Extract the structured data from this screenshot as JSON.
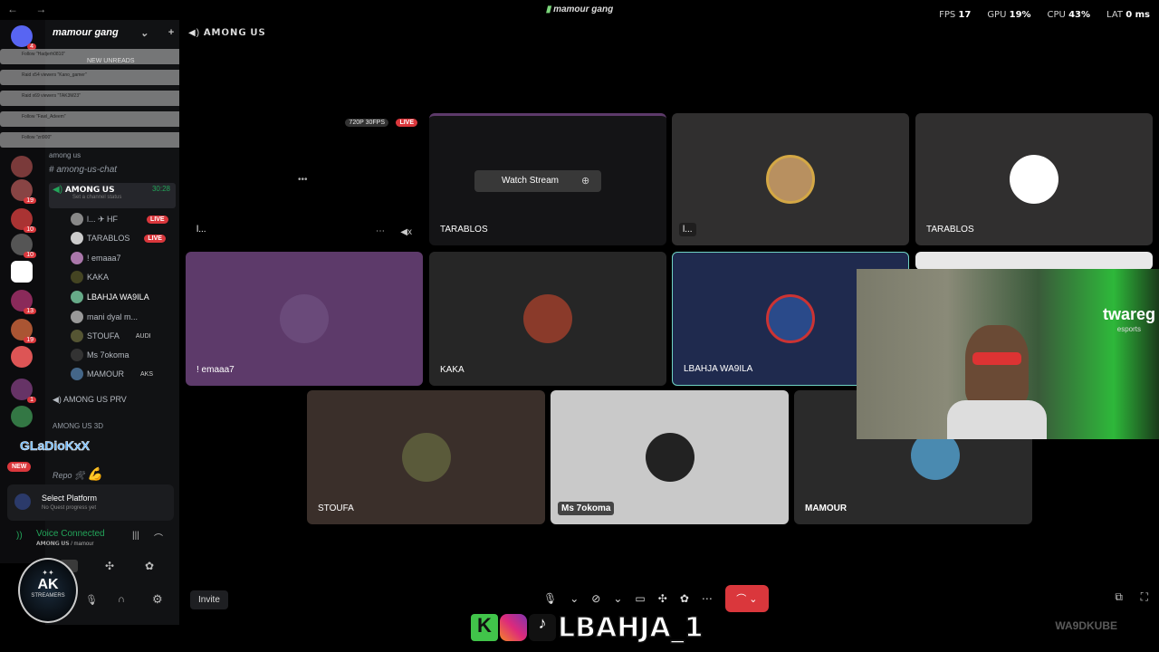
{
  "titlebar": {
    "nav": "← →",
    "title": "mamour gang"
  },
  "stats": [
    {
      "label": "FPS",
      "value": "17"
    },
    {
      "label": "GPU",
      "value": "19%"
    },
    {
      "label": "CPU",
      "value": "43%"
    },
    {
      "label": "LAT",
      "value": "0 ms"
    }
  ],
  "server": {
    "name": "mamour gang"
  },
  "notifications": [
    "Follow \"Hadjerh0810\"",
    "Raid x54 viewers \"Kano_gamer\"",
    "Raid x69 viewers \"TAK3M23\"",
    "Follow \"Fawl_Adeem\"",
    "Follow \"zri900\""
  ],
  "new_unreads": "NEW UNREADS",
  "channels": {
    "category_among": "among us",
    "text_channel": "among-us-chat",
    "voice_channel": "𝗔𝗠𝗢𝗡𝗚 𝗨𝗦",
    "voice_timer": "30:28",
    "status_hint": "Set a channel status",
    "voice_2": "AMONG US PRV",
    "category_3d": "AMONG US 3D",
    "repo": "Repo 🛠"
  },
  "voice_users": [
    {
      "name": "l... ✈ HF",
      "live": "LIVE"
    },
    {
      "name": "TARABLOS",
      "live": "LIVE"
    },
    {
      "name": "! emaaa7",
      "live": ""
    },
    {
      "name": "KAKA",
      "live": ""
    },
    {
      "name": "LBAHJA WA9ILA",
      "live": ""
    },
    {
      "name": "mani dyal m...",
      "live": ""
    },
    {
      "name": "STOUFA",
      "live": "",
      "tag": "AUDI"
    },
    {
      "name": "Ms 7okoma",
      "live": ""
    },
    {
      "name": "MAMOUR",
      "live": "",
      "tag": "AKS"
    }
  ],
  "overlay_name": "GLaDioKxX",
  "new_badge": "NEW",
  "quest": {
    "title": "Select Platform",
    "sub": "No Quest progress yet"
  },
  "voice_status": {
    "title": "Voice Connected",
    "sub": "𝗔𝗠𝗢𝗡𝗚 𝗨𝗦 / mamour"
  },
  "stage": {
    "header": "𝗔𝗠𝗢𝗡𝗚 𝗨𝗦",
    "tile1_quality": "720P 30FPS",
    "tile1_live": "LIVE",
    "tile1_name": "l...",
    "watch_stream": "Watch Stream",
    "tiles": [
      {
        "name": "TARABLOS"
      },
      {
        "name": "l..."
      },
      {
        "name": "TARABLOS"
      },
      {
        "name": "! emaaa7"
      },
      {
        "name": "KAKA"
      },
      {
        "name": "LBAHJA WA9ILA"
      },
      {
        "name": "STOUFA"
      },
      {
        "name": "Ms 7okoma"
      },
      {
        "name": "MAMOUR"
      }
    ],
    "invite": "Invite"
  },
  "logo": {
    "top": "AK",
    "bottom": "STREAMERS"
  },
  "webcam": {
    "brand": "twareg",
    "sub": "esports"
  },
  "bottom": {
    "handle": "LBAHJA_1",
    "ghost": "WA9DKUBE"
  },
  "colors": {
    "accent_live": "#da373c",
    "voice_green": "#23a55a",
    "tile_purple": "#5d3a6a",
    "tile_navy": "#1f2a4e"
  }
}
